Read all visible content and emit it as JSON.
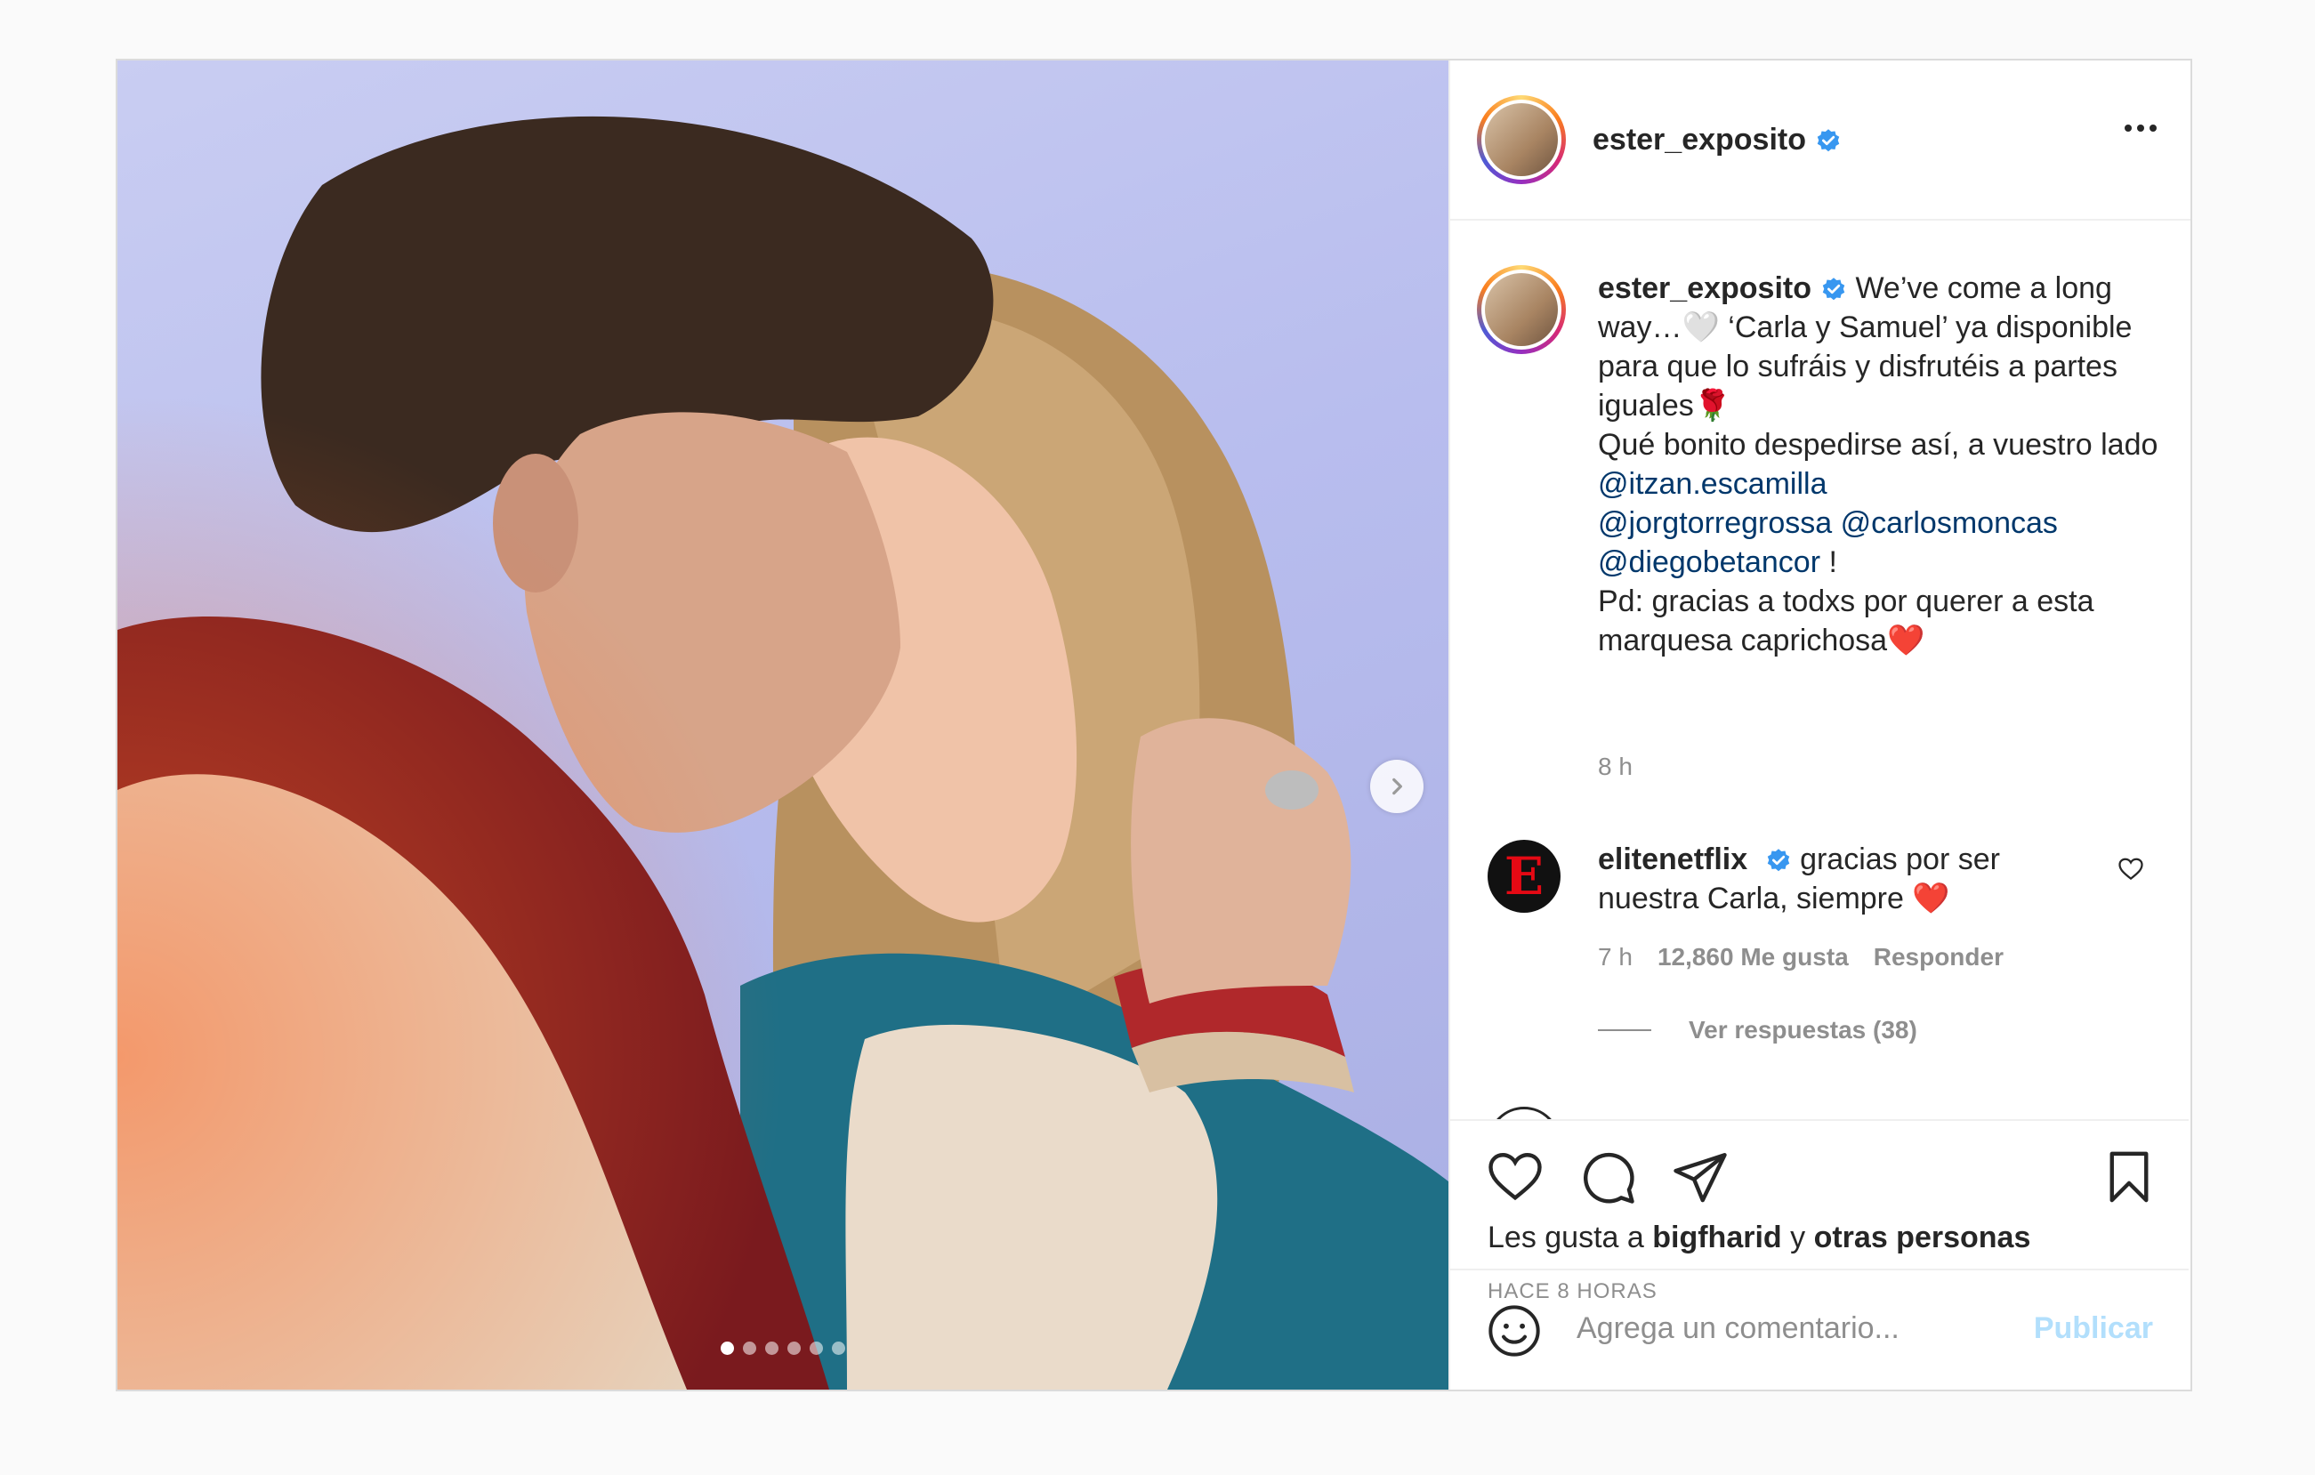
{
  "colors": {
    "mention": "#00376b",
    "verified": "#3897f0",
    "publish_disabled": "#b2dffc",
    "heart_emoji": "#ed4956",
    "rose_emoji": "#c6172c"
  },
  "post": {
    "media": {
      "carousel_count": 6,
      "active_index": 0,
      "next_icon": "chevron-right-icon"
    },
    "header": {
      "username": "ester_exposito",
      "verified_icon": "verified-badge-icon",
      "more_icon": "more-options-icon"
    },
    "caption": {
      "username": "ester_exposito",
      "line1": " We’ve come a long way…",
      "emoji_white_heart": "🤍",
      "line2": " ‘Carla y Samuel’ ya disponible para que lo sufráis y disfrutéis a partes iguales",
      "emoji_rose": "🌹",
      "line3": "Qué bonito despedirse así, a vuestro lado ",
      "mention1": "@itzan.escamilla",
      "mention2": "@jorgtorregrossa",
      "mention3": "@carlosmoncas",
      "mention4": "@diegobetancor",
      "after_mentions": " !",
      "line4": "Pd: gracias a todxs por querer a esta marquesa caprichosa",
      "emoji_red_heart": "❤️",
      "time": "8 h"
    },
    "comment": {
      "username": "elitenetflix",
      "avatar_letter": "E",
      "text": " gracias por ser nuestra Carla, siempre ",
      "emoji": "❤️",
      "time": "7 h",
      "likes": "12,860 Me gusta",
      "reply": "Responder",
      "view_replies": "Ver respuestas (38)"
    },
    "actions": {
      "like_icon": "heart-icon",
      "comment_icon": "comment-icon",
      "share_icon": "send-icon",
      "save_icon": "bookmark-icon",
      "likes_prefix": "Les gusta a ",
      "likes_user": "bigfharid",
      "likes_mid": " y ",
      "likes_others": "otras personas",
      "timestamp": "HACE 8 HORAS"
    },
    "composer": {
      "emoji_icon": "smiley-icon",
      "placeholder": "Agrega un comentario...",
      "publish": "Publicar"
    }
  }
}
